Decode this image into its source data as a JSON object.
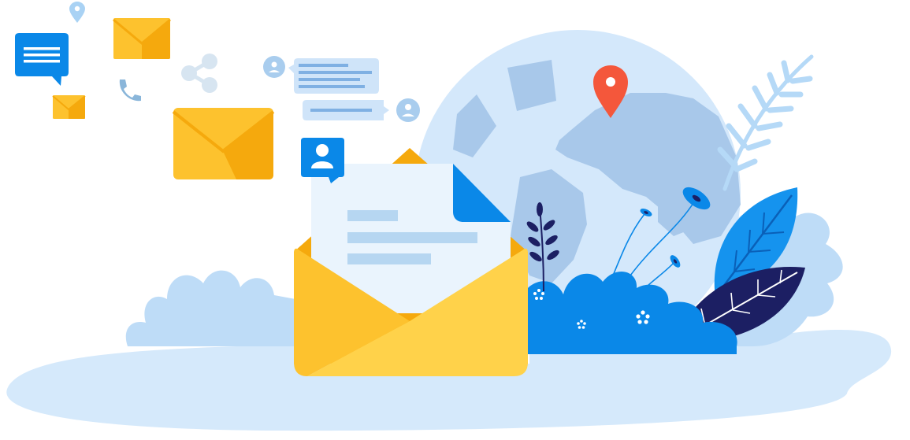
{
  "illustration": {
    "subject": "email-and-global-communication",
    "icons": [
      "location-pin-icon",
      "chat-bubble-icon",
      "envelope-icon",
      "phone-icon",
      "share-icon",
      "user-avatar-icon",
      "user-profile-icon",
      "open-envelope-icon",
      "letter-icon",
      "globe-icon",
      "map-pin-icon",
      "fern-leaf-icon",
      "plant-leaf-icon",
      "flower-icon"
    ]
  },
  "colors": {
    "ground": "#d5e9fb",
    "bush": "#bedcf7",
    "globe_water": "#d4e8fb",
    "globe_land": "#a8c8ea",
    "envelope_yellow": "#fdc22e",
    "envelope_dark": "#f5a90d",
    "envelope_light": "#ffd24a",
    "accent_blue": "#0a88e8",
    "leaf_blue": "#1593ee",
    "dark_navy": "#1c1f63",
    "pin_red": "#f4573b",
    "paper": "#eaf4fd",
    "paper_lines": "#b6d6f1",
    "chat_box": "#cfe4f9",
    "chat_lines": "#7fb0e3",
    "avatar_circle": "#a9cdee",
    "fern": "#b5d9f7",
    "phone_icon": "#8ab6da",
    "share_icon": "#d7e5f1"
  }
}
